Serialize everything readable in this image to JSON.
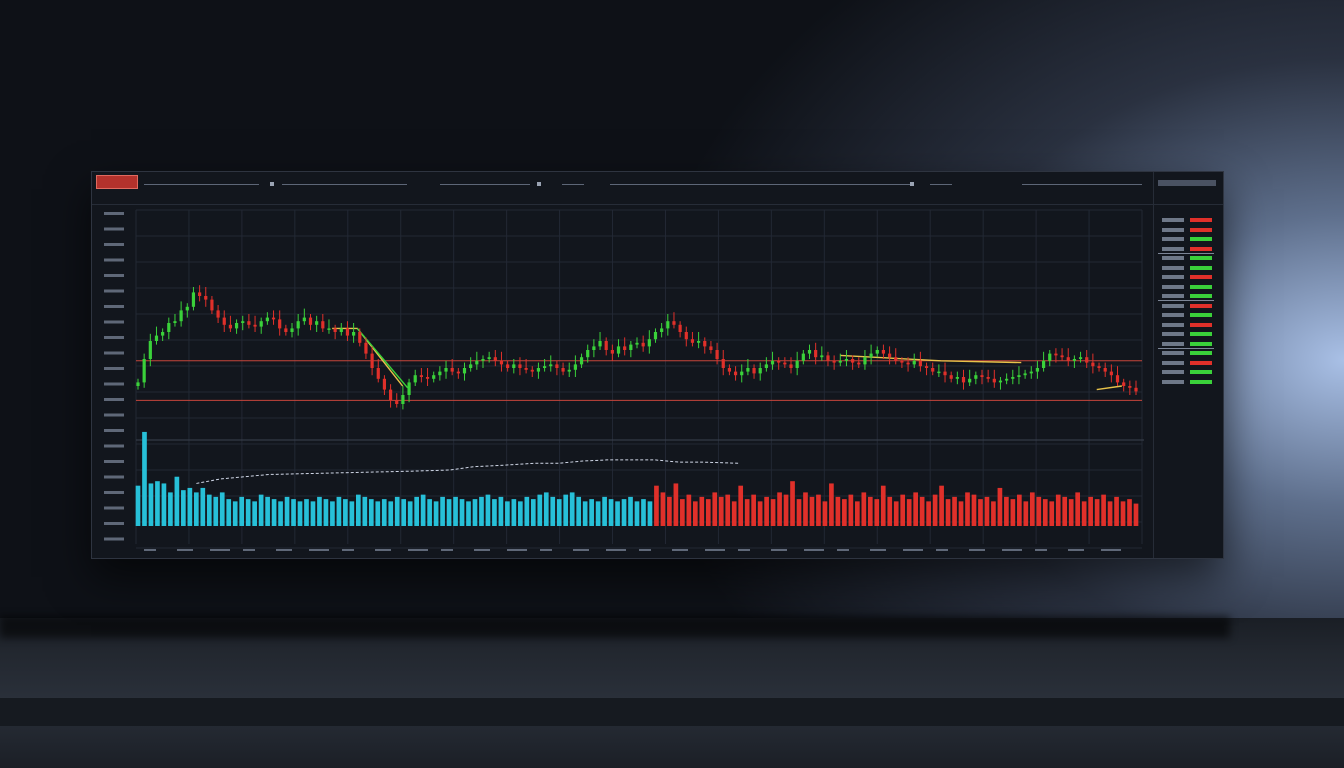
{
  "chart_data": [
    {
      "type": "line",
      "name": "price",
      "style": "candlestick",
      "colors": {
        "up": "#3ad13a",
        "down": "#e0302a",
        "background": "#12161d",
        "grid": "#222834"
      },
      "ylim": [
        0,
        100
      ],
      "xlim": [
        0,
        100
      ],
      "grid": true,
      "closes": [
        22,
        35,
        45,
        48,
        50,
        55,
        56,
        62,
        64,
        72,
        70,
        68,
        62,
        58,
        54,
        52,
        55,
        56,
        54,
        53,
        56,
        58,
        57,
        52,
        50,
        52,
        56,
        58,
        54,
        56,
        52,
        52,
        50,
        52,
        48,
        50,
        44,
        38,
        30,
        24,
        18,
        12,
        10,
        15,
        22,
        26,
        25,
        24,
        26,
        28,
        30,
        28,
        27,
        30,
        32,
        34,
        35,
        36,
        34,
        32,
        30,
        32,
        30,
        29,
        28,
        30,
        31,
        32,
        30,
        28,
        29,
        32,
        36,
        40,
        42,
        45,
        40,
        38,
        42,
        40,
        43,
        44,
        42,
        46,
        50,
        52,
        56,
        54,
        50,
        46,
        44,
        45,
        42,
        40,
        35,
        30,
        28,
        26,
        28,
        30,
        27,
        30,
        32,
        34,
        33,
        32,
        30,
        34,
        38,
        40,
        36,
        37,
        34,
        33,
        34,
        35,
        33,
        32,
        36,
        38,
        40,
        38,
        36,
        34,
        33,
        32,
        34,
        31,
        30,
        28,
        28,
        26,
        24,
        25,
        22,
        24,
        26,
        25,
        24,
        22,
        23,
        24,
        25,
        26,
        27,
        28,
        30,
        34,
        38,
        37,
        36,
        34,
        35,
        36,
        33,
        31,
        30,
        28,
        26,
        22,
        20,
        19,
        17
      ],
      "overlays": [
        {
          "kind": "resistance",
          "y": 34,
          "color": "#c5453b"
        },
        {
          "kind": "support",
          "y": 12,
          "color": "#c5453b"
        },
        {
          "kind": "curve",
          "color": "#e7c24a",
          "points": [
            [
              19.5,
              52
            ],
            [
              22,
              52
            ],
            [
              26.5,
              20
            ]
          ]
        },
        {
          "kind": "curve",
          "color": "#3ad13a",
          "points": [
            [
              22,
              52
            ],
            [
              27,
              19
            ]
          ]
        },
        {
          "kind": "curve",
          "color": "#e7c24a",
          "points": [
            [
              70,
              37
            ],
            [
              80,
              34
            ],
            [
              88,
              33
            ]
          ]
        },
        {
          "kind": "curve",
          "color": "#e7c24a",
          "points": [
            [
              95.5,
              18
            ],
            [
              98,
              20
            ]
          ]
        }
      ]
    },
    {
      "type": "bar",
      "name": "volume",
      "colors": {
        "first": "#27c0d8",
        "second": "#e0302a",
        "avg_line": "#cfd6e6"
      },
      "ylim": [
        0,
        100
      ],
      "split_index": 80,
      "values": [
        36,
        84,
        38,
        40,
        38,
        30,
        44,
        32,
        34,
        30,
        34,
        28,
        26,
        30,
        24,
        22,
        26,
        24,
        22,
        28,
        26,
        24,
        22,
        26,
        24,
        22,
        24,
        22,
        26,
        24,
        22,
        26,
        24,
        22,
        28,
        26,
        24,
        22,
        24,
        22,
        26,
        24,
        22,
        26,
        28,
        24,
        22,
        26,
        24,
        26,
        24,
        22,
        24,
        26,
        28,
        24,
        26,
        22,
        24,
        22,
        26,
        24,
        28,
        30,
        26,
        24,
        28,
        30,
        26,
        22,
        24,
        22,
        26,
        24,
        22,
        24,
        26,
        22,
        24,
        22,
        36,
        30,
        26,
        38,
        24,
        28,
        22,
        26,
        24,
        30,
        26,
        28,
        22,
        36,
        24,
        28,
        22,
        26,
        24,
        30,
        28,
        40,
        24,
        30,
        26,
        28,
        22,
        38,
        26,
        24,
        28,
        22,
        30,
        26,
        24,
        36,
        26,
        22,
        28,
        24,
        30,
        26,
        22,
        28,
        36,
        24,
        26,
        22,
        30,
        28,
        24,
        26,
        22,
        34,
        26,
        24,
        28,
        22,
        30,
        26,
        24,
        22,
        28,
        26,
        24,
        30,
        22,
        26,
        24,
        28,
        22,
        26,
        22,
        24,
        20
      ],
      "avg_line": [
        [
          10,
          38
        ],
        [
          14,
          42
        ],
        [
          22,
          46
        ],
        [
          30,
          47
        ],
        [
          38,
          48
        ],
        [
          46,
          49
        ],
        [
          52,
          50
        ],
        [
          56,
          53
        ],
        [
          60,
          54
        ],
        [
          66,
          56
        ],
        [
          70,
          56
        ],
        [
          74,
          58
        ],
        [
          78,
          59
        ],
        [
          82,
          59
        ],
        [
          86,
          59
        ],
        [
          90,
          57
        ],
        [
          94,
          57
        ],
        [
          100,
          56
        ]
      ]
    }
  ]
}
